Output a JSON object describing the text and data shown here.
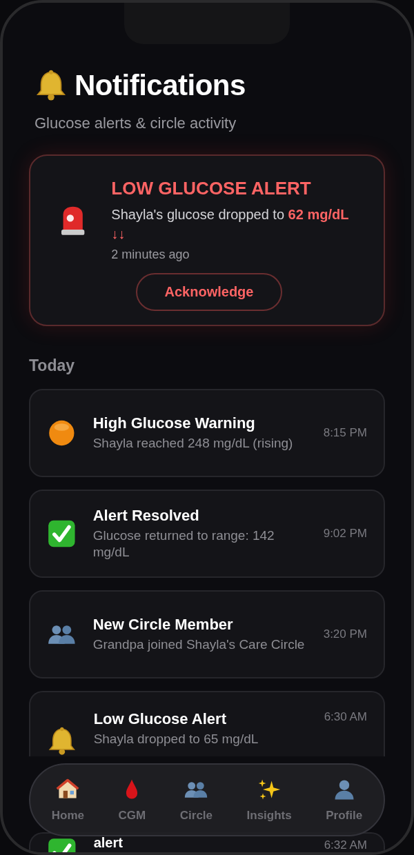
{
  "header": {
    "title": "Notifications",
    "subtitle": "Glucose alerts & circle activity"
  },
  "alert": {
    "title": "LOW GLUCOSE ALERT",
    "message": "Shayla's glucose dropped to **62 mg/dL ↓↓**",
    "time": "2 minutes ago",
    "button": "Acknowledge"
  },
  "section": "Today",
  "items": [
    {
      "kind": "high",
      "title": "High Glucose Warning",
      "detail": "Shayla reached 248 mg/dL (rising)",
      "time": "8:15 PM"
    },
    {
      "kind": "resolved",
      "title": "Alert Resolved",
      "detail": "Glucose returned to range: 142 mg/dL",
      "time": "9:02 PM"
    },
    {
      "kind": "member",
      "title": "New Circle Member",
      "detail": "Grandpa joined Shayla's Care Circle",
      "time": "3:20 PM"
    },
    {
      "kind": "low",
      "title": "Low Glucose Alert",
      "detail": "Shayla dropped to 65 mg/dL",
      "time": "6:30 AM"
    },
    {
      "kind": "resolved",
      "title": "alert",
      "time": "6:32 AM"
    }
  ],
  "nav": [
    {
      "label": "Home"
    },
    {
      "label": "CGM"
    },
    {
      "label": "Circle"
    },
    {
      "label": "Insights"
    },
    {
      "label": "Profile"
    }
  ]
}
